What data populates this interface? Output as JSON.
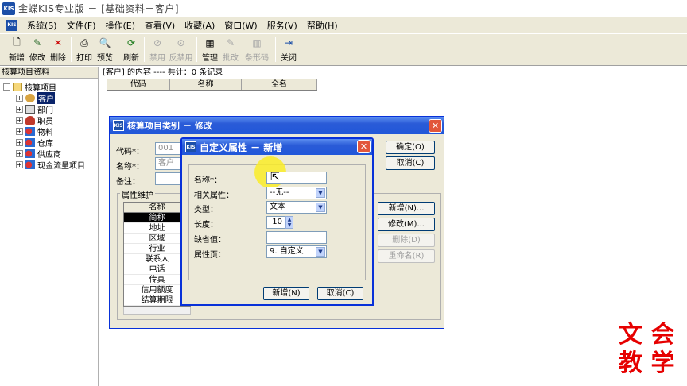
{
  "window": {
    "title": "金蝶KIS专业版 － [基础资料－客户]"
  },
  "menu": [
    "系统(S)",
    "文件(F)",
    "操作(E)",
    "查看(V)",
    "收藏(A)",
    "窗口(W)",
    "服务(V)",
    "帮助(H)"
  ],
  "toolbar": {
    "new": "新增",
    "modify": "修改",
    "delete": "删除",
    "print": "打印",
    "preview": "预览",
    "refresh": "刷新",
    "disable": "禁用",
    "undisable": "反禁用",
    "manage": "管理",
    "batch_change": "批改",
    "barcode": "条形码",
    "close": "关闭"
  },
  "left_pane": {
    "header": "核算项目资料",
    "root": "核算项目",
    "items": [
      "客户",
      "部门",
      "职员",
      "物料",
      "仓库",
      "供应商",
      "现金流量项目"
    ]
  },
  "right_pane": {
    "header": "[客户] 的内容 ---- 共计：0 条记录",
    "columns": [
      "代码",
      "名称",
      "全名"
    ]
  },
  "dialog_category": {
    "title": "核算项目类别 － 修改",
    "code_label": "代码*：",
    "code_value": "001",
    "name_label": "名称*：",
    "name_value": "客户",
    "note_label": "备注：",
    "group_label": "属性维护",
    "list_header": "名称",
    "properties": [
      "简称",
      "地址",
      "区域",
      "行业",
      "联系人",
      "电话",
      "传真",
      "信用额度",
      "结算期限"
    ],
    "ok_button": "确定(O)",
    "cancel_button": "取消(C)",
    "add_button": "新增(N)...",
    "modify_button": "修改(M)...",
    "delete_button": "删除(D)",
    "rename_button": "重命名(R)"
  },
  "dialog_custom": {
    "title": "自定义属性 － 新增",
    "name_label": "名称*：",
    "name_value": "",
    "related_label": "相关属性：",
    "related_value": "--无--",
    "type_label": "类型：",
    "type_value": "文本",
    "length_label": "长度：",
    "length_value": "10",
    "default_label": "缺省值：",
    "default_value": "",
    "page_label": "属性页：",
    "page_value": "9. 自定义",
    "add_button": "新增(N)",
    "cancel_button": "取消(C)"
  },
  "watermark": {
    "line1": "文 会",
    "line2": "教 学"
  },
  "colors": {
    "title_blue": "#2157d9",
    "selection": "#0a246a",
    "close_red": "#e2563b",
    "watermark_red": "#e60000",
    "cursor_highlight": "#faec28"
  }
}
